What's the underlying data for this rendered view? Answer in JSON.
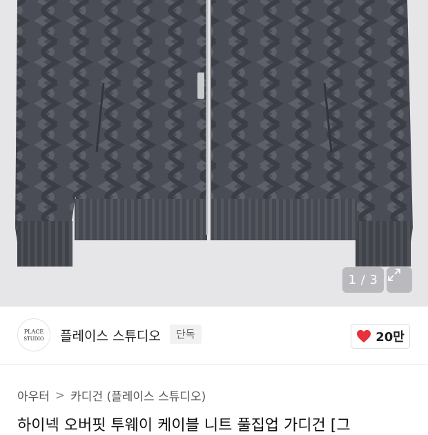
{
  "gallery": {
    "counter": "1 / 3",
    "current_page": 1,
    "total_pages": 3,
    "background_color": "#e6e6e8",
    "product_color": "#4a4c55",
    "expand_icon": "expand-icon"
  },
  "brand": {
    "logo_text": "PLACE STUDIO",
    "name": "플레이스 스튜디오",
    "badge": "단독"
  },
  "like": {
    "icon": "heart-icon",
    "count": "20만",
    "color": "#e8313b"
  },
  "breadcrumb": {
    "items": [
      "아우터",
      "카디건 (플레이스 스튜디오)"
    ],
    "separator": ">"
  },
  "product": {
    "title": "하이넥 오버핏 투웨이 케이블 니트 풀집업 가디건 [그"
  }
}
